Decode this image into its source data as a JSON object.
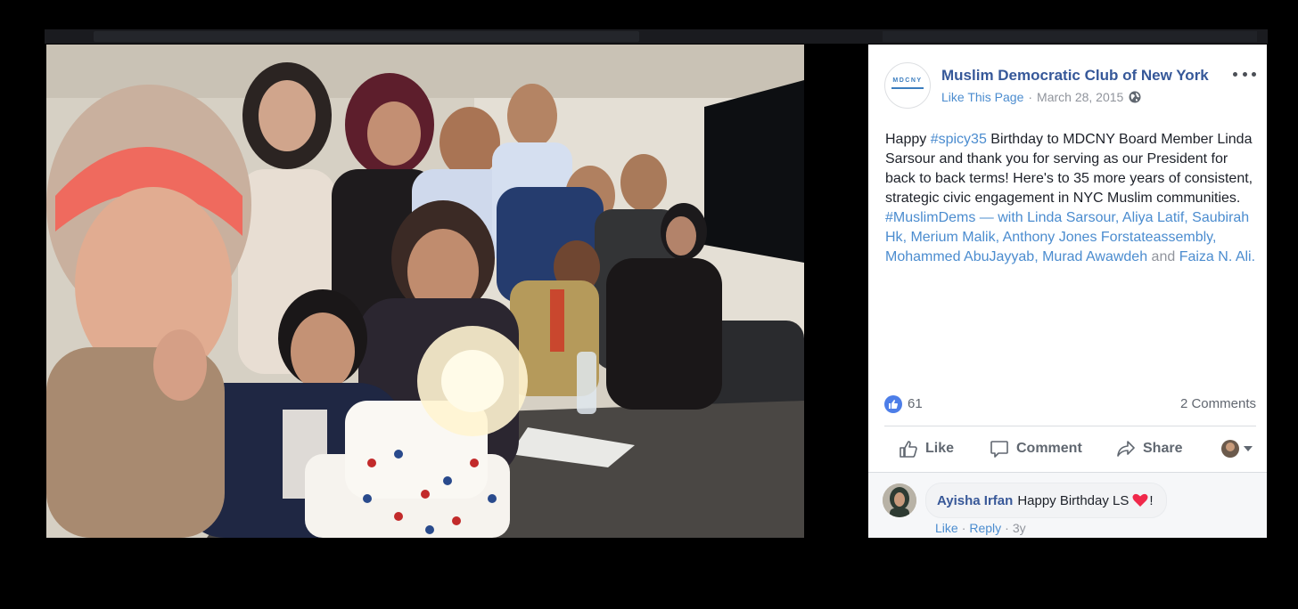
{
  "post": {
    "page_name": "Muslim Democratic Club of New York",
    "logo_text": "MDCNY",
    "like_page": "Like This Page",
    "separator": "·",
    "date": "March 28, 2015",
    "text": {
      "t1": "Happy ",
      "hashtag1": "#spicy35",
      "t2": " Birthday to MDCNY Board Member Linda Sarsour and thank you for serving as our President for back to back terms! Here's to 35 more years of consistent, strategic civic engagement in NYC Muslim communities. ",
      "hashtag2": "#MuslimDems",
      "with": " — with ",
      "tags": [
        "Linda Sarsour",
        "Aliya Latif",
        "Saubirah Hk",
        "Merium Malik",
        "Anthony Jones Forstateassembly",
        "Mohammed AbuJayyab",
        "Murad Awawdeh",
        "Faiza N. Ali."
      ],
      "comma": ", ",
      "and": " and "
    },
    "reaction_count": "61",
    "comment_count": "2 Comments",
    "actions": {
      "like": "Like",
      "comment": "Comment",
      "share": "Share"
    }
  },
  "comment": {
    "author": "Ayisha Irfan",
    "text": "Happy Birthday LS",
    "suffix": "!",
    "like": "Like",
    "reply": "Reply",
    "dot": "·",
    "time": "3y"
  },
  "colors": {
    "link": "#4b8ccf",
    "page_name": "#365899",
    "like_blue": "#4d7ee8",
    "heart": "#f0284a"
  },
  "icons": [
    "more-icon",
    "globe-icon",
    "like-reaction-icon",
    "like-icon",
    "comment-icon",
    "share-icon",
    "caret-down-icon",
    "heart-icon"
  ]
}
